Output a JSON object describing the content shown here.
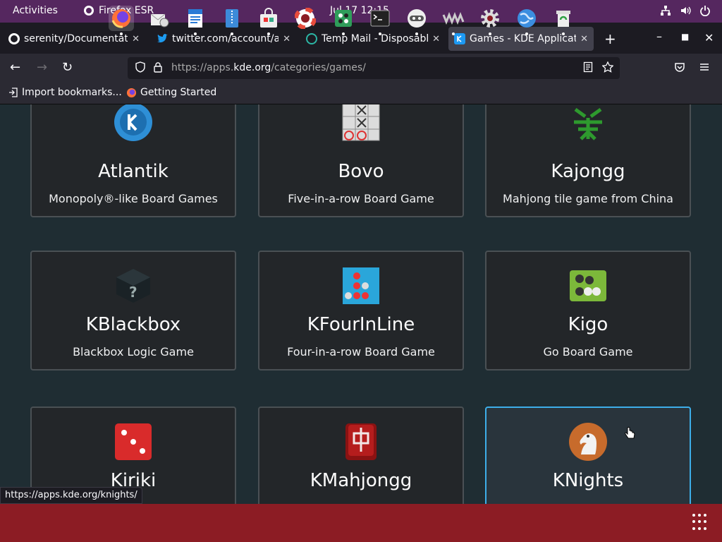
{
  "topbar": {
    "activities": "Activities",
    "app_name": "Firefox ESR",
    "clock": "Jul 17  12:15"
  },
  "tabs": [
    {
      "title": "serenity/Documentation",
      "icon": "github-icon"
    },
    {
      "title": "twitter.com/account/ac",
      "icon": "twitter-icon"
    },
    {
      "title": "Temp Mail - Disposable",
      "icon": "tempmail-icon"
    },
    {
      "title": "Games - KDE Applicatio",
      "icon": "kde-icon",
      "active": true
    }
  ],
  "urlbar": {
    "url_prefix": "https://apps.",
    "url_host": "kde.org",
    "url_path": "/categories/games/"
  },
  "bookmarks": [
    {
      "label": "Import bookmarks...",
      "icon": "import-icon"
    },
    {
      "label": "Getting Started",
      "icon": "firefox-icon"
    }
  ],
  "cards": [
    {
      "name": "Atlantik",
      "desc": "Monopoly®-like Board Games",
      "icon": "atlantik-icon"
    },
    {
      "name": "Bovo",
      "desc": "Five-in-a-row Board Game",
      "icon": "bovo-icon"
    },
    {
      "name": "Kajongg",
      "desc": "Mahjong tile game from China",
      "icon": "kajongg-icon"
    },
    {
      "name": "KBlackbox",
      "desc": "Blackbox Logic Game",
      "icon": "kblackbox-icon"
    },
    {
      "name": "KFourInLine",
      "desc": "Four-in-a-row Board Game",
      "icon": "kfourinline-icon"
    },
    {
      "name": "Kigo",
      "desc": "Go Board Game",
      "icon": "kigo-icon"
    },
    {
      "name": "Kiriki",
      "desc": "",
      "icon": "kiriki-icon"
    },
    {
      "name": "KMahjongg",
      "desc": "",
      "icon": "kmahjongg-icon"
    },
    {
      "name": "KNights",
      "desc": "",
      "icon": "knights-icon"
    }
  ],
  "status_link": "https://apps.kde.org/knights/",
  "dock": [
    "firefox-icon",
    "evolution-icon",
    "writer-icon",
    "archive-icon",
    "software-icon",
    "help-icon",
    "games-icon",
    "terminal-icon",
    "cheese-icon",
    "vlc-icon",
    "settings-icon",
    "browser-icon",
    "recycle-icon"
  ],
  "colors": {
    "topbar": "#55275f",
    "dock": "#8c1c24",
    "active_tab": "#42414d",
    "hover_border": "#3daee9"
  }
}
